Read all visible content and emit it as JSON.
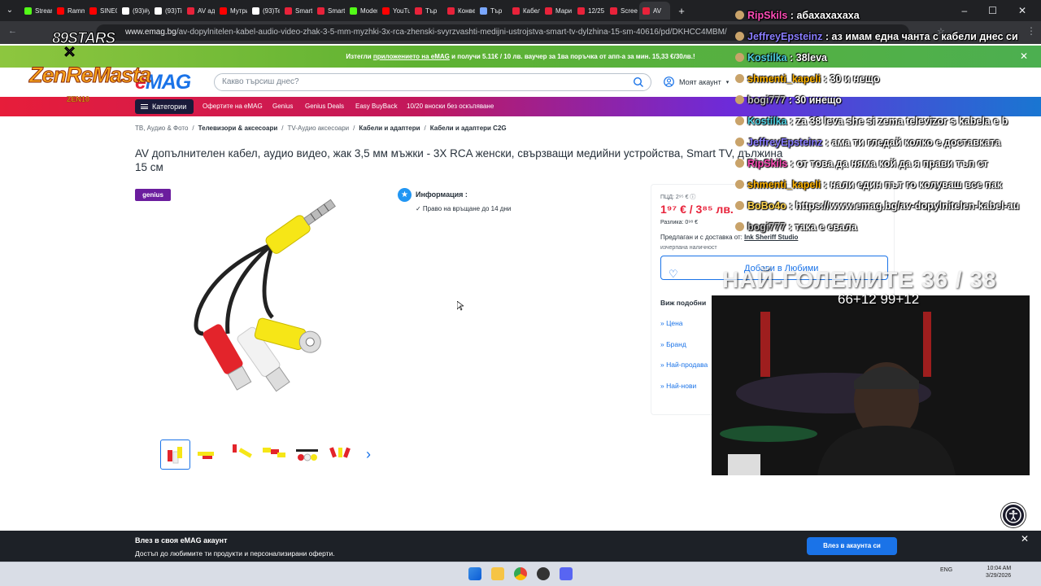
{
  "tabs": [
    {
      "label": "Stream",
      "color": "#53fc18"
    },
    {
      "label": "Ramm",
      "color": "#ff0000"
    },
    {
      "label": "SINEO",
      "color": "#ff0000"
    },
    {
      "label": "(93)#y",
      "color": "#ffffff"
    },
    {
      "label": "(93)Tik",
      "color": "#ffffff"
    },
    {
      "label": "AV ада",
      "color": "#e8223a"
    },
    {
      "label": "Мутри",
      "color": "#ff0000"
    },
    {
      "label": "(93)Te",
      "color": "#ffffff"
    },
    {
      "label": "Smart",
      "color": "#e8223a"
    },
    {
      "label": "Smart",
      "color": "#e8223a"
    },
    {
      "label": "Moder",
      "color": "#53fc18"
    },
    {
      "label": "YouTul",
      "color": "#ff0000"
    },
    {
      "label": "Тър",
      "color": "#e8223a"
    },
    {
      "label": "Конве",
      "color": "#e8223a"
    },
    {
      "label": "Тър",
      "color": "#7aa7ff"
    },
    {
      "label": "Кабел",
      "color": "#e8223a"
    },
    {
      "label": "Мари",
      "color": "#e8223a"
    },
    {
      "label": "12/25",
      "color": "#e8223a"
    },
    {
      "label": "Screen",
      "color": "#e8223a"
    },
    {
      "label": "AV",
      "color": "#e8223a"
    }
  ],
  "url": {
    "host": "www.emag.bg",
    "path": "/av-dopylnitelen-kabel-audio-video-zhak-3-5-mm-myzhki-3x-rca-zhenski-svyrzvashti-medijni-ustrojstva-smart-tv-dylzhina-15-sm-40616/pd/DKHCC4MBM/"
  },
  "promo": {
    "pre": "Изтегли",
    "link": "приложението на eMAG",
    "post": "и получи 5.11€ / 10 лв. ваучер за 1ва поръчка от апп-а за мин. 15,33 €/30лв.!"
  },
  "header": {
    "logo_e": "e",
    "logo_rest": "MAG",
    "search_placeholder": "Какво търсиш днес?",
    "account": "Моят акаунт"
  },
  "nav": {
    "categories": "Категории",
    "links": [
      "Офертите на eMAG",
      "Genius",
      "Genius Deals",
      "Easy BuyBack",
      "10/20 вноски без оскъпяване"
    ]
  },
  "breadcrumb": [
    "ТВ, Аудио & Фото",
    "Телевизори & аксесоари",
    "TV-Аудио аксесоари",
    "Кабели и адаптери",
    "Кабели и адаптери C2G"
  ],
  "product": {
    "title": "AV допълнителен кабел, аудио видео, жак 3,5 мм мъжки - 3X RCA женски, свързващи медийни устройства, Smart TV, дължина 15 см",
    "genius_badge": "genius",
    "info_title": "Информация :",
    "info_item": "✓ Право на връщане до 14 дни"
  },
  "price": {
    "pcd": "ПЦД: 2⁹⁵ € ⓘ",
    "price": "1⁹⁷ € / 3⁸⁵ лв.",
    "difference": "Разлика: 0⁹⁸ €",
    "seller_label": "Предлаган и с доставка от:",
    "seller_name": "Ink Sheriff Studio",
    "availability": "изчерпана наличност",
    "favorites_button": "Добави в Любими",
    "similar_title": "Виж подобни",
    "similar_links": [
      "» Цена",
      "» Бранд",
      "» Най-продава",
      "» Най-нови"
    ]
  },
  "login": {
    "title": "Влез в своя eMAG акаунт",
    "subtitle": "Достъп до любимите ти продукти и персонализирани оферти.",
    "button": "Влез в акаунта си"
  },
  "taskbar": {
    "lang": "ENG",
    "time": "10:04 AM",
    "date": "3/29/2026"
  },
  "overlay": {
    "brand_stars": "89STARS",
    "brand_x": "✕",
    "brand_name": "ZenReMasta",
    "brand_sub": "ZEN10",
    "counter": "НАЙ-ГОЛЕМИТЕ 36 / 38",
    "subcount": "66+12 99+12"
  },
  "chat": [
    {
      "user": "RipSkils",
      "color": "#ff4db8",
      "msg": "абахахахаха"
    },
    {
      "user": "JeffreyEpsteinz",
      "color": "#8a7dff",
      "msg": "аз имам една чанта с кабели днес си"
    },
    {
      "user": "Kostilka",
      "color": "#4dd0e1",
      "msg": "38leva"
    },
    {
      "user": "shmenti_kapeli",
      "color": "#ffb300",
      "msg": "30 и нещо"
    },
    {
      "user": "bogi777",
      "color": "#bdbdbd",
      "msg": "30 инещо"
    },
    {
      "user": "Kostilka",
      "color": "#4dd0e1",
      "msg": "za 38 leva she si zema televizor s kabela e b"
    },
    {
      "user": "JeffreyEpsteinz",
      "color": "#8a7dff",
      "msg": "ама ти гледай колко е доставката"
    },
    {
      "user": "RipSkils",
      "color": "#ff4db8",
      "msg": "от това да няма кой да я прави тъп ст"
    },
    {
      "user": "shmenti_kapeli",
      "color": "#ffb300",
      "msg": "нали един път го колуваш все пак"
    },
    {
      "user": "BoBo4o",
      "color": "#ffd54f",
      "msg": "https://www.emag.bg/av-dopylnitelen-kabel-au"
    },
    {
      "user": "bogi777",
      "color": "#bdbdbd",
      "msg": "така е евала"
    }
  ]
}
